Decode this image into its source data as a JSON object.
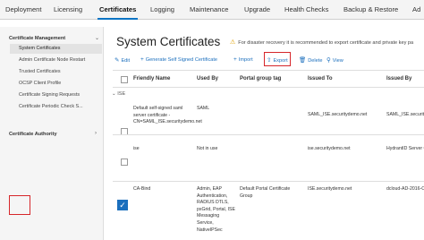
{
  "nav": {
    "tabs": [
      {
        "label": "Deployment"
      },
      {
        "label": "Licensing"
      },
      {
        "label": "Certificates"
      },
      {
        "label": "Logging"
      },
      {
        "label": "Maintenance"
      },
      {
        "label": "Upgrade"
      },
      {
        "label": "Health Checks"
      },
      {
        "label": "Backup & Restore"
      },
      {
        "label": "Ad"
      }
    ],
    "active_tab": "Certificates"
  },
  "sidebar": {
    "sections": [
      {
        "title": "Certificate Management",
        "items": [
          {
            "label": "System Certificates"
          },
          {
            "label": "Admin Certificate Node Restart"
          },
          {
            "label": "Trusted Certificates"
          },
          {
            "label": "OCSP Client Profile"
          },
          {
            "label": "Certificate Signing Requests"
          },
          {
            "label": "Certificate Periodic Check S..."
          }
        ]
      },
      {
        "title": "Certificate Authority",
        "items": []
      }
    ],
    "selected_item": "System Certificates"
  },
  "main": {
    "title": "System Certificates",
    "notice": "For disaster recovery it is recommended to export certificate and private key pa",
    "toolbar": {
      "edit": "Edit",
      "generate": "Generate Self Signed Certificate",
      "import": "Import",
      "export": "Export",
      "delete": "Delete",
      "view": "View"
    },
    "columns": [
      "Friendly Name",
      "Used By",
      "Portal group tag",
      "Issued To",
      "Issued By"
    ],
    "group_label": "ISE",
    "rows": [
      {
        "friendly_name": "Default self-signed saml server certificate - CN=SAML_ISE.securitydemo.net",
        "used_by": "SAML",
        "portal_group_tag": "",
        "issued_to": "SAML_ISE.securitydemo.net",
        "issued_by": "SAML_ISE.securitydem",
        "checked": false
      },
      {
        "friendly_name": "ise",
        "used_by": "Not in use",
        "portal_group_tag": "",
        "issued_to": "ise.securitydemo.net",
        "issued_by": "HydrantID Server CA OV",
        "checked": false
      },
      {
        "friendly_name": "CA-Bind",
        "used_by": "Admin, EAP Authentication, RADIUS DTLS, pxGrid, Portal, ISE Messaging Service, NativeIPSec",
        "portal_group_tag": "Default Portal Certificate Group",
        "issued_to": "ISE.securitydemo.net",
        "issued_by": "dcloud-AD-2016-CA",
        "checked": true
      }
    ]
  },
  "colors": {
    "accent": "#1b6fbd",
    "highlight": "#d6262a",
    "warning": "#e0a000"
  }
}
